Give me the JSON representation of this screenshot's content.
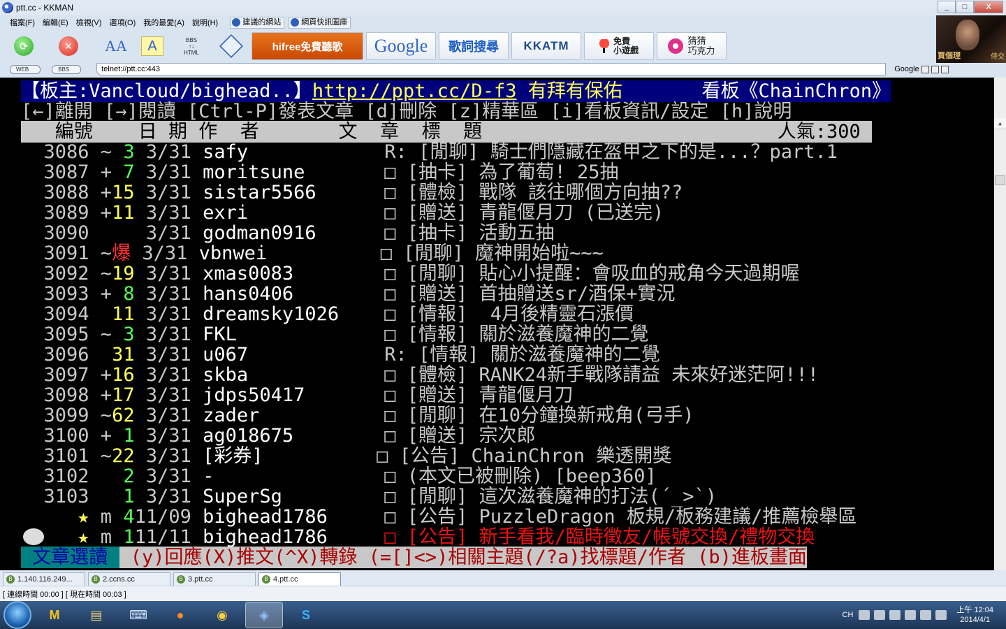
{
  "window": {
    "title": "ptt.cc - KKMAN",
    "min": "_",
    "max": "□",
    "close": "X"
  },
  "menu": [
    "檔案(F)",
    "編輯(E)",
    "檢視(V)",
    "選項(O)",
    "我的最愛(A)",
    "說明(H)"
  ],
  "favorites": [
    "建議的網站",
    "網頁快訊圖庫"
  ],
  "toolbar": {
    "bbs_label": "BBS\n↑↓\nHTML",
    "ads": {
      "hifree": "hifree免費聽歌",
      "google": "Google",
      "lyric": "歌詞搜尋",
      "kkatm": "KKATM",
      "game": "免費\n小遊戲",
      "choco": "猜猜\n巧克力"
    },
    "thumb_caption": "買個理",
    "thumb_caption2": "侍交"
  },
  "address": {
    "mode_web": "WEB",
    "mode_bbs": "BBS",
    "url": "telnet://ptt.cc:443",
    "search_label": "Google"
  },
  "board": {
    "header_left": "【板主:Vancloud/bighead..】",
    "header_url": "http://ppt.cc/D-f3",
    "header_pray": " 有拜有保佑",
    "header_board": "       看板《ChainChron》",
    "nav": "[←]離開 [→]閱讀 [Ctrl-P]發表文章 [d]刪除 [z]精華區 [i]看板資訊/設定 [h]說明",
    "list_header": "   編號    日 期 作  者       文  章  標  題                          人氣:300 ",
    "posts": [
      {
        "num": "  3086",
        "mark": " ~",
        "push": " 3",
        "push_color": "green",
        "date": " 3/31",
        "author": " safy          ",
        "type": "  R:",
        "title": " [閒聊] 騎士們隱藏在盔甲之下的是...？part.1"
      },
      {
        "num": "  3087",
        "mark": " +",
        "push": " 7",
        "push_color": "green",
        "date": " 3/31",
        "author": " moritsune     ",
        "type": "  □",
        "title": " [抽卡] 為了葡萄! 25抽"
      },
      {
        "num": "  3088",
        "mark": " +",
        "push": "15",
        "push_color": "yellow",
        "date": " 3/31",
        "author": " sistar5566    ",
        "type": "  □",
        "title": " [體檢] 戰隊 該往哪個方向抽??"
      },
      {
        "num": "  3089",
        "mark": " +",
        "push": "11",
        "push_color": "yellow",
        "date": " 3/31",
        "author": " exri          ",
        "type": "  □",
        "title": " [贈送] 青龍偃月刀 (已送完)"
      },
      {
        "num": "  3090",
        "mark": "  ",
        "push": "  ",
        "push_color": "none",
        "date": " 3/31",
        "author": " godman0916    ",
        "type": "  □",
        "title": " [抽卡] 活動五抽"
      },
      {
        "num": "  3091",
        "mark": " ~",
        "push": "爆",
        "push_color": "red",
        "date": " 3/31",
        "author": " vbnwei        ",
        "type": "  □",
        "title": " [閒聊] 魔神開始啦~~~"
      },
      {
        "num": "  3092",
        "mark": " ~",
        "push": "19",
        "push_color": "yellow",
        "date": " 3/31",
        "author": " xmas0083      ",
        "type": "  □",
        "title": " [閒聊] 貼心小提醒：會吸血的戒角今天過期喔"
      },
      {
        "num": "  3093",
        "mark": " +",
        "push": " 8",
        "push_color": "green",
        "date": " 3/31",
        "author": " hans0406      ",
        "type": "  □",
        "title": " [贈送] 首抽贈送sr/酒保+實況"
      },
      {
        "num": "  3094",
        "mark": "  ",
        "push": "11",
        "push_color": "yellow",
        "date": " 3/31",
        "author": " dreamsky1026  ",
        "type": "  □",
        "title": " [情報]  4月後精靈石漲價"
      },
      {
        "num": "  3095",
        "mark": " ~",
        "push": " 3",
        "push_color": "green",
        "date": " 3/31",
        "author": " FKL           ",
        "type": "  □",
        "title": " [情報] 關於滋養魔神的二覺"
      },
      {
        "num": "  3096",
        "mark": "  ",
        "push": "31",
        "push_color": "yellow",
        "date": " 3/31",
        "author": " u067          ",
        "type": "  R:",
        "title": " [情報] 關於滋養魔神的二覺"
      },
      {
        "num": "  3097",
        "mark": " +",
        "push": "16",
        "push_color": "yellow",
        "date": " 3/31",
        "author": " skba          ",
        "type": "  □",
        "title": " [體檢] RANK24新手戰隊請益 未來好迷茫阿!!!"
      },
      {
        "num": "  3098",
        "mark": " +",
        "push": "17",
        "push_color": "yellow",
        "date": " 3/31",
        "author": " jdps50417     ",
        "type": "  □",
        "title": " [贈送] 青龍偃月刀"
      },
      {
        "num": "  3099",
        "mark": " ~",
        "push": "62",
        "push_color": "yellow",
        "date": " 3/31",
        "author": " zader         ",
        "type": "  □",
        "title": " [閒聊] 在10分鐘換新戒角(弓手)"
      },
      {
        "num": "  3100",
        "mark": " +",
        "push": " 1",
        "push_color": "green",
        "date": " 3/31",
        "author": " ag018675      ",
        "type": "  □",
        "title": " [贈送] 宗次郎"
      },
      {
        "num": "  3101",
        "mark": " ~",
        "push": "22",
        "push_color": "yellow",
        "date": " 3/31",
        "author": " [彩券]        ",
        "type": "  □",
        "title": " [公告] ChainChron 樂透開獎"
      },
      {
        "num": "  3102",
        "mark": "  ",
        "push": " 2",
        "push_color": "green",
        "date": " 3/31",
        "author": " -             ",
        "type": "  □",
        "title": " (本文已被刪除) [beep360]"
      },
      {
        "num": "  3103",
        "mark": "  ",
        "push": " 1",
        "push_color": "green",
        "date": " 3/31",
        "author": " SuperSg       ",
        "type": "  □",
        "title": " [閒聊] 這次滋養魔神的打法(´_>`)"
      },
      {
        "num": "     ★",
        "mark": " m",
        "push": " 4",
        "push_color": "green",
        "date": "11/09",
        "author": " bighead1786   ",
        "type": "  □",
        "title": " [公告] PuzzleDragon 板規/板務建議/推薦檢舉區"
      },
      {
        "num": "     ★",
        "mark": " m",
        "push": " 1",
        "push_color": "green",
        "date": "11/11",
        "author": " bighead1786   ",
        "type": "  □",
        "title": " [公告] 新手看我/臨時徵友/帳號交換/禮物交換"
      }
    ],
    "footer_left": " 文章選讀 ",
    "footer_right": " (y)回應(X)推文(^X)轉錄 (=[]<>)相關主題(/?a)找標題/作者 (b)進板畫面"
  },
  "tabs": [
    "1.140.116.249...",
    "2.ccns.cc",
    "3.ptt.cc",
    "4.ptt.cc"
  ],
  "status": "[ 連線時間 00:00 ] [ 現在時間 00:03 ]",
  "tray": {
    "lang": "CH",
    "time": "上午 12:04",
    "date": "2014/4/1"
  }
}
